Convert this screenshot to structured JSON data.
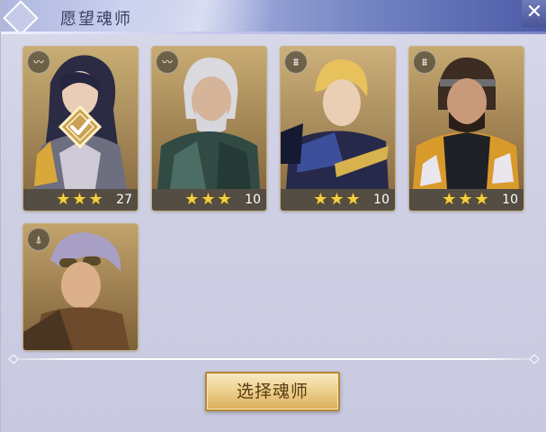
{
  "window": {
    "title": "愿望魂师",
    "close_glyph": "✕"
  },
  "cards": [
    {
      "stars": "★★★",
      "level": "27",
      "selected": true,
      "class_icon": "wing-icon",
      "class_glyph": "〰"
    },
    {
      "stars": "★★★",
      "level": "10",
      "selected": false,
      "class_icon": "wing-icon",
      "class_glyph": "〰"
    },
    {
      "stars": "★★★",
      "level": "10",
      "selected": false,
      "class_icon": "fortress-icon",
      "class_glyph": "⩩"
    },
    {
      "stars": "★★★",
      "level": "10",
      "selected": false,
      "class_icon": "fortress-icon",
      "class_glyph": "⩩"
    },
    {
      "stars": "",
      "level": "",
      "selected": false,
      "class_icon": "tower-icon",
      "class_glyph": "⍋"
    }
  ],
  "footer": {
    "select_button_label": "选择魂师"
  },
  "colors": {
    "star": "#f4cf45",
    "button_gold": "#eccf8a",
    "title_bar": "#6f7fc0"
  }
}
